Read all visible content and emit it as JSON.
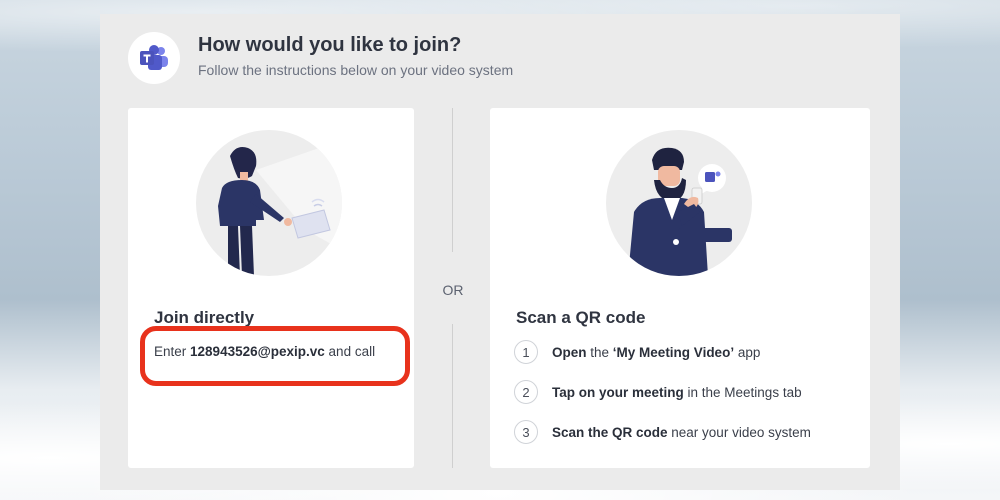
{
  "header": {
    "title": "How would you like to join?",
    "subtitle": "Follow the instructions below on your video system"
  },
  "divider": {
    "label": "OR"
  },
  "join_directly": {
    "heading": "Join directly",
    "prefix": "Enter ",
    "address": "128943526@pexip.vc",
    "suffix": " and call"
  },
  "qr": {
    "heading": "Scan a QR code",
    "steps": [
      {
        "num": "1",
        "bold": "Open",
        "rest": " the ‘My Meeting Video’ app"
      },
      {
        "num": "2",
        "bold": "Tap on your meeting",
        "rest": " in the Meetings tab"
      },
      {
        "num": "3",
        "bold": "Scan the QR code",
        "rest": " near your video system"
      }
    ]
  },
  "icons": {
    "teams_logo": "microsoft-teams-icon",
    "join_illustration": "person-at-tablet-illustration",
    "qr_illustration": "person-with-phone-illustration"
  },
  "colors": {
    "teams_purple": "#5059c9",
    "highlight": "#e8321c",
    "navy": "#2b3566"
  },
  "qr_step_bold_middle": "‘My Meeting Video’"
}
